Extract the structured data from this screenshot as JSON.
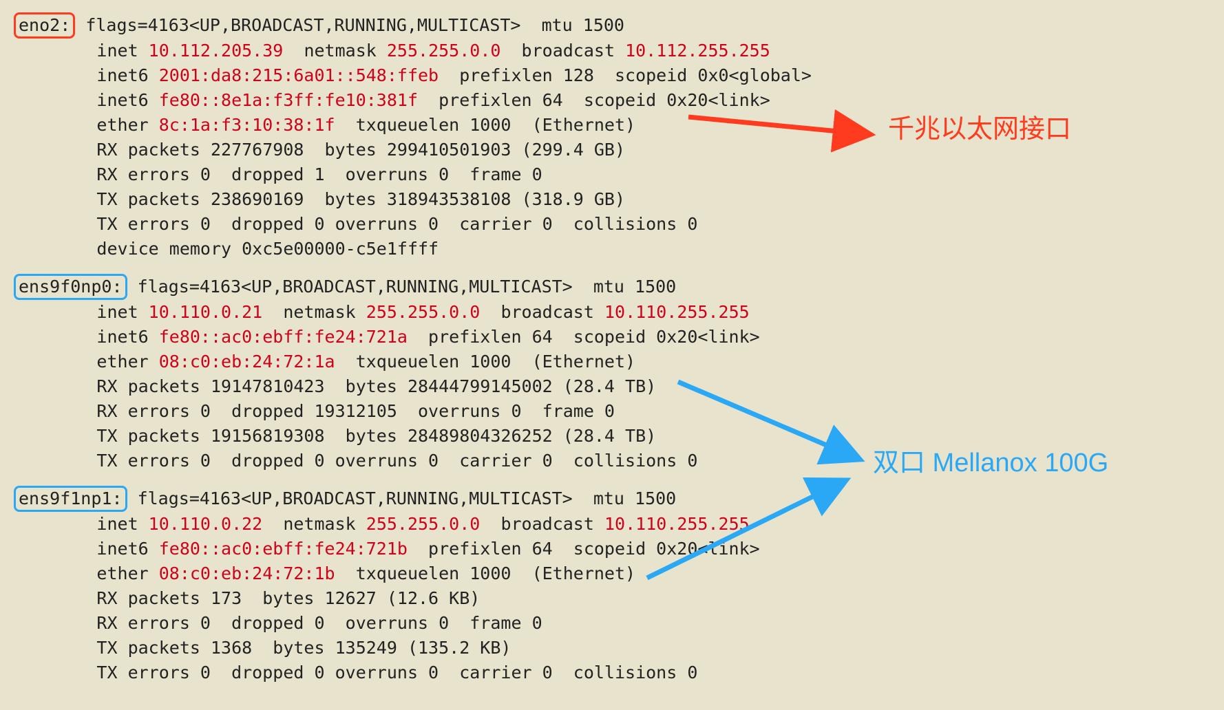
{
  "annotations": {
    "gigabit_label": "千兆以太网接口",
    "mellanox_label": "双口 Mellanox 100G"
  },
  "interfaces": [
    {
      "name": "eno2:",
      "box_class": "box-red",
      "flags_line": " flags=4163<UP,BROADCAST,RUNNING,MULTICAST>  mtu 1500",
      "rows": [
        {
          "pre": "        inet ",
          "addr": "10.112.205.39",
          "mid": "  netmask ",
          "mask": "255.255.0.0",
          "mid2": "  broadcast ",
          "bcast": "10.112.255.255",
          "tail": ""
        },
        {
          "pre": "        inet6 ",
          "addr": "2001:da8:215:6a01::548:ffeb",
          "tail": "  prefixlen 128  scopeid 0x0<global>"
        },
        {
          "pre": "        inet6 ",
          "addr": "fe80::8e1a:f3ff:fe10:381f",
          "tail": "  prefixlen 64  scopeid 0x20<link>"
        },
        {
          "pre": "        ether ",
          "addr": "8c:1a:f3:10:38:1f",
          "tail": "  txqueuelen 1000  (Ethernet)"
        }
      ],
      "stats": [
        "        RX packets 227767908  bytes 299410501903 (299.4 GB)",
        "        RX errors 0  dropped 1  overruns 0  frame 0",
        "        TX packets 238690169  bytes 318943538108 (318.9 GB)",
        "        TX errors 0  dropped 0 overruns 0  carrier 0  collisions 0",
        "        device memory 0xc5e00000-c5e1ffff"
      ]
    },
    {
      "name": "ens9f0np0:",
      "box_class": "box-blue",
      "flags_line": " flags=4163<UP,BROADCAST,RUNNING,MULTICAST>  mtu 1500",
      "rows": [
        {
          "pre": "        inet ",
          "addr": "10.110.0.21",
          "mid": "  netmask ",
          "mask": "255.255.0.0",
          "mid2": "  broadcast ",
          "bcast": "10.110.255.255",
          "tail": ""
        },
        {
          "pre": "        inet6 ",
          "addr": "fe80::ac0:ebff:fe24:721a",
          "tail": "  prefixlen 64  scopeid 0x20<link>"
        },
        {
          "pre": "        ether ",
          "addr": "08:c0:eb:24:72:1a",
          "tail": "  txqueuelen 1000  (Ethernet)"
        }
      ],
      "stats": [
        "        RX packets 19147810423  bytes 28444799145002 (28.4 TB)",
        "        RX errors 0  dropped 19312105  overruns 0  frame 0",
        "        TX packets 19156819308  bytes 28489804326252 (28.4 TB)",
        "        TX errors 0  dropped 0 overruns 0  carrier 0  collisions 0"
      ]
    },
    {
      "name": "ens9f1np1:",
      "box_class": "box-blue",
      "flags_line": " flags=4163<UP,BROADCAST,RUNNING,MULTICAST>  mtu 1500",
      "rows": [
        {
          "pre": "        inet ",
          "addr": "10.110.0.22",
          "mid": "  netmask ",
          "mask": "255.255.0.0",
          "mid2": "  broadcast ",
          "bcast": "10.110.255.255",
          "tail": ""
        },
        {
          "pre": "        inet6 ",
          "addr": "fe80::ac0:ebff:fe24:721b",
          "tail": "  prefixlen 64  scopeid 0x20<link>"
        },
        {
          "pre": "        ether ",
          "addr": "08:c0:eb:24:72:1b",
          "tail": "  txqueuelen 1000  (Ethernet)"
        }
      ],
      "stats": [
        "        RX packets 173  bytes 12627 (12.6 KB)",
        "        RX errors 0  dropped 0  overruns 0  frame 0",
        "        TX packets 1368  bytes 135249 (135.2 KB)",
        "        TX errors 0  dropped 0 overruns 0  carrier 0  collisions 0"
      ]
    }
  ]
}
